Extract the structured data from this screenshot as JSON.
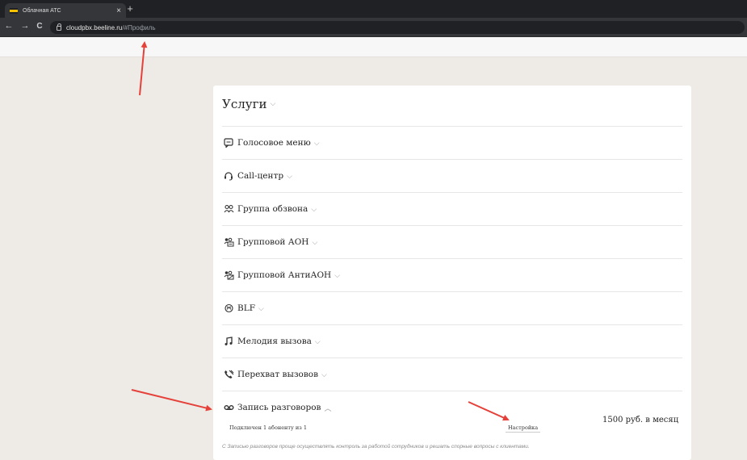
{
  "browser": {
    "tab_title": "Облачная АТС",
    "tab_close": "×",
    "new_tab": "+",
    "back": "←",
    "forward": "→",
    "reload": "C",
    "url_host": "cloudpbx.beeline.ru",
    "url_path": "/#Профиль"
  },
  "services": {
    "title": "Услуги",
    "items": [
      {
        "label": "Голосовое меню",
        "icon": "chat-bubble-icon"
      },
      {
        "label": "Call-центр",
        "icon": "headset-icon"
      },
      {
        "label": "Группа обзвона",
        "icon": "group-icon"
      },
      {
        "label": "Групповой АОН",
        "icon": "group-caller-id-icon"
      },
      {
        "label": "Групповой АнтиАОН",
        "icon": "group-anti-caller-id-icon"
      },
      {
        "label": "BLF",
        "icon": "blf-icon"
      },
      {
        "label": "Мелодия вызова",
        "icon": "music-note-icon"
      },
      {
        "label": "Перехват вызовов",
        "icon": "call-pickup-icon"
      },
      {
        "label": "Запись разговоров",
        "icon": "voicemail-icon"
      }
    ],
    "recording": {
      "status": "Подключен 1 абоненту из 1",
      "setup_label": "Настройка",
      "price": "1500 руб. в месяц",
      "description": "С Записью разговоров проще осуществлять контроль за работой сотрудников и решать спорные вопросы с клиентами."
    }
  },
  "colors": {
    "page_bg": "#eeebe6",
    "card_bg": "#ffffff",
    "annotation_arrow": "#e5413a",
    "beeline_yellow": "#f6c200"
  }
}
